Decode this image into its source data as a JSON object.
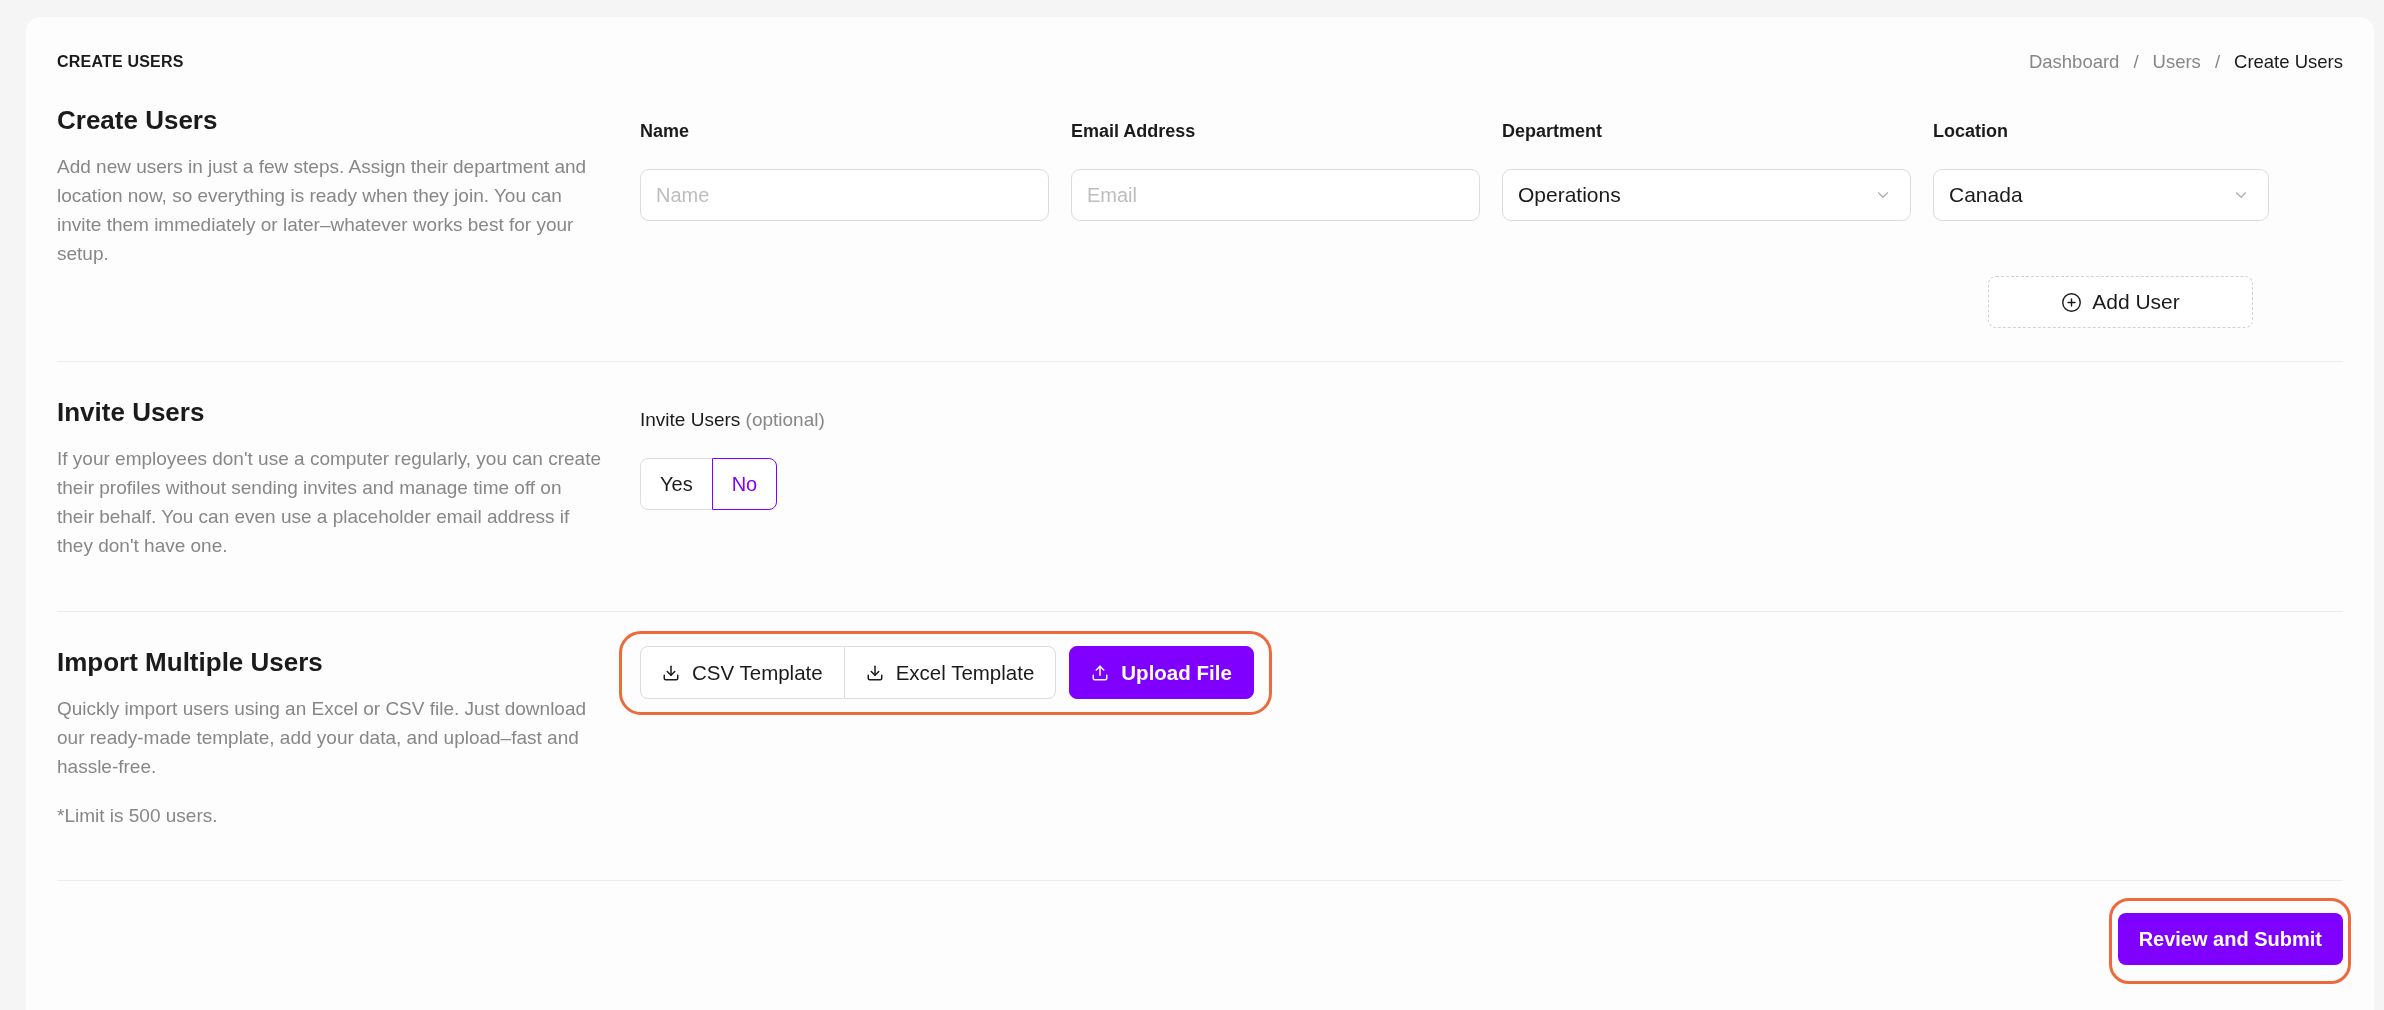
{
  "header": {
    "title": "CREATE USERS",
    "breadcrumb": [
      {
        "kind": "link",
        "label": "Dashboard"
      },
      {
        "kind": "separator",
        "label": "/"
      },
      {
        "kind": "link",
        "label": "Users"
      },
      {
        "kind": "separator",
        "label": "/"
      },
      {
        "kind": "current",
        "label": "Create Users"
      }
    ]
  },
  "create_users": {
    "title": "Create Users",
    "description": "Add new users in just a few steps. Assign their department and location now, so everything is ready when they join. You can invite them immediately or later–whatever works best for your setup.",
    "fields": [
      {
        "kind": "text",
        "label": "Name",
        "placeholder": "Name"
      },
      {
        "kind": "text",
        "label": "Email Address",
        "placeholder": "Email"
      },
      {
        "kind": "select",
        "label": "Department",
        "value": "Operations"
      },
      {
        "kind": "select",
        "label": "Location",
        "value": "Canada"
      }
    ],
    "add_button": "Add User"
  },
  "invite_users": {
    "title": "Invite Users",
    "description": "If your employees don't use a computer regularly, you can create their profiles without sending invites and manage time off on their behalf. You can even use a placeholder email address if they don't have one.",
    "field_label": "Invite Users",
    "field_hint": "(optional)",
    "options": [
      {
        "label": "Yes",
        "selected": false
      },
      {
        "label": "No",
        "selected": true
      }
    ]
  },
  "import_users": {
    "title": "Import Multiple Users",
    "description": "Quickly import users using an Excel or CSV file. Just download our ready-made template, add your data, and upload–fast and hassle-free.",
    "note": "*Limit is 500 users.",
    "buttons": [
      {
        "kind": "download",
        "label": "CSV Template"
      },
      {
        "kind": "download",
        "label": "Excel Template"
      },
      {
        "kind": "upload",
        "label": "Upload File"
      }
    ],
    "highlighted": true
  },
  "footer": {
    "submit_button": "Review and Submit",
    "highlighted": true
  }
}
